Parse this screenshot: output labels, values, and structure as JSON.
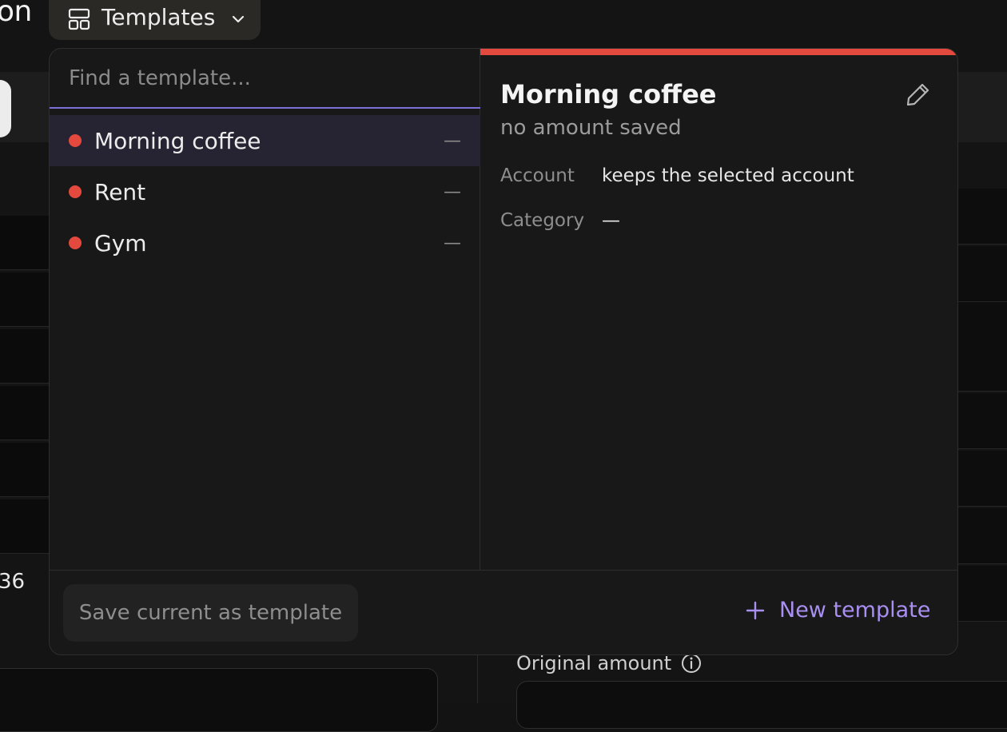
{
  "background": {
    "title_fragment": "on",
    "number_fragment": "36",
    "original_amount_label": "Original amount"
  },
  "trigger": {
    "label": "Templates"
  },
  "search": {
    "placeholder": "Find a template..."
  },
  "templates": [
    {
      "label": "Morning coffee",
      "value": "—",
      "selected": true,
      "color": "#e4493d"
    },
    {
      "label": "Rent",
      "value": "—",
      "selected": false,
      "color": "#e4493d"
    },
    {
      "label": "Gym",
      "value": "—",
      "selected": false,
      "color": "#e4493d"
    }
  ],
  "detail": {
    "title": "Morning coffee",
    "subtitle": "no amount saved",
    "accent_color": "#e4493d",
    "fields": [
      {
        "key": "Account",
        "value": "keeps the selected account"
      },
      {
        "key": "Category",
        "value": "—"
      }
    ]
  },
  "footer": {
    "save_label": "Save current as template",
    "new_label": "New template"
  },
  "colors": {
    "accent_purple": "#a98ff2",
    "focus_underline": "#7c6fd6",
    "selected_row": "#262433"
  }
}
